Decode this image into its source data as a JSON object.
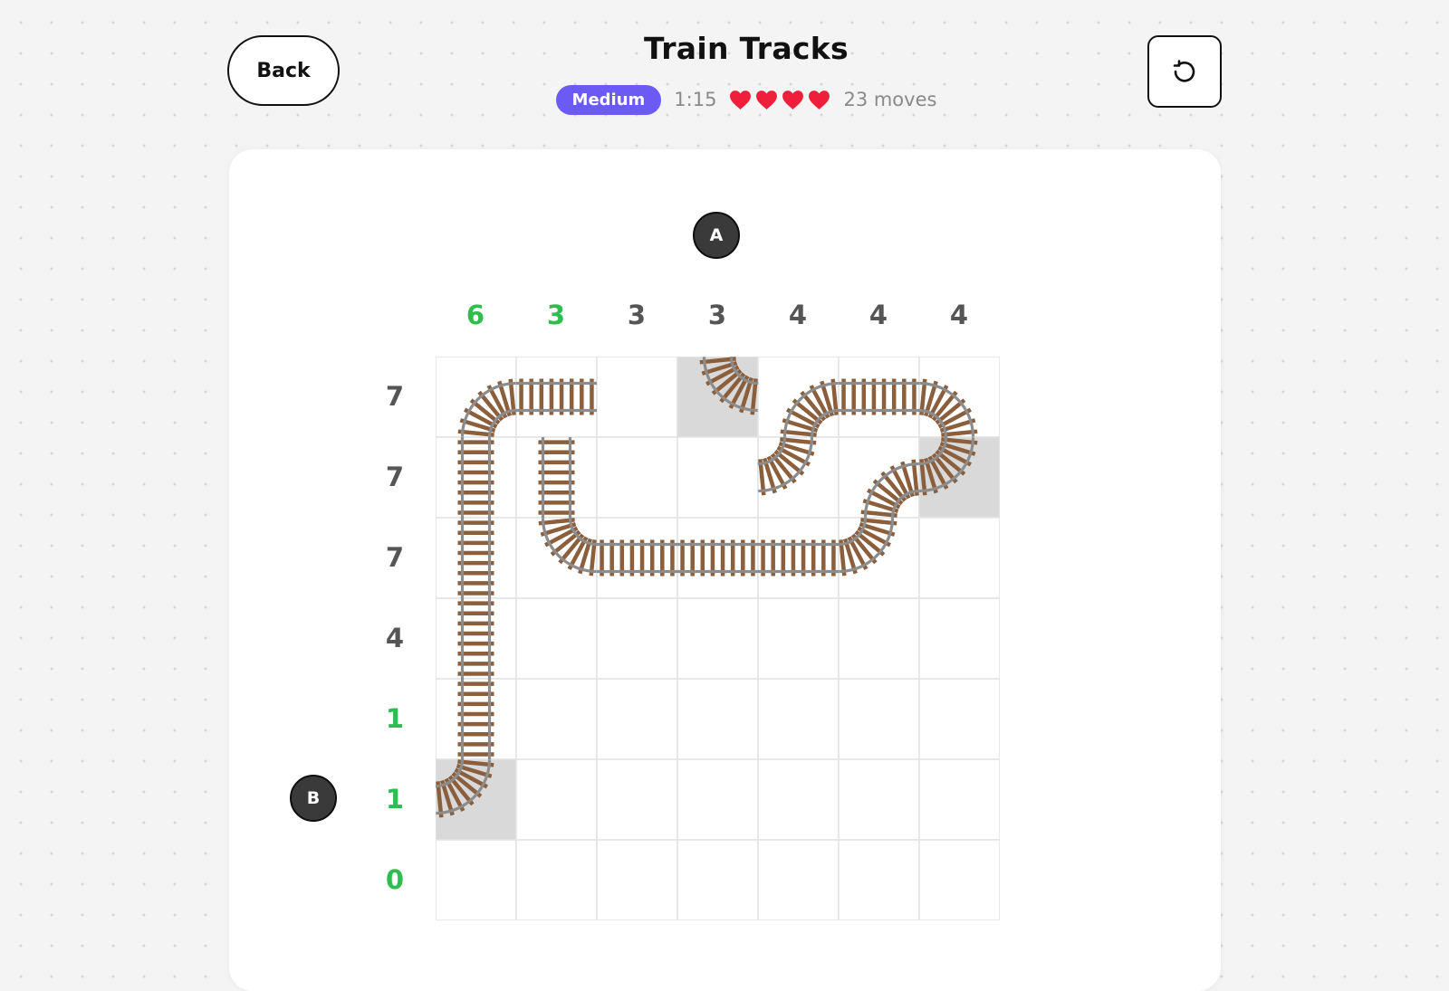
{
  "header": {
    "back_label": "Back",
    "title": "Train Tracks",
    "difficulty": "Medium",
    "timer": "1:15",
    "lives": 4,
    "moves": "23 moves",
    "accent_color": "#6b5bf4"
  },
  "icons": {
    "reset": "reset-icon",
    "heart": "heart-icon"
  },
  "puzzle": {
    "size": 7,
    "col_clues": [
      "6",
      "3",
      "3",
      "3",
      "4",
      "4",
      "4"
    ],
    "col_satisfied": [
      true,
      true,
      false,
      false,
      false,
      false,
      false
    ],
    "row_clues": [
      "7",
      "7",
      "7",
      "4",
      "1",
      "1",
      "0"
    ],
    "row_satisfied": [
      false,
      false,
      false,
      false,
      true,
      true,
      true
    ],
    "station_a": "A",
    "station_b": "B",
    "satisfied_color": "#2ebd4e",
    "unsatisfied_color": "#555555",
    "cells": [
      [
        "ES",
        "EW",
        "",
        "NE",
        "ES",
        "EW",
        "SW"
      ],
      [
        "NS",
        "NS",
        "",
        "",
        "NW",
        "ES",
        "NW"
      ],
      [
        "NS",
        "NE",
        "EW",
        "EW",
        "EW",
        "NW",
        ""
      ],
      [
        "NS",
        "",
        "",
        "",
        "",
        "",
        ""
      ],
      [
        "NS",
        "",
        "",
        "",
        "",
        "",
        ""
      ],
      [
        "NW",
        "",
        "",
        "",
        "",
        "",
        ""
      ],
      [
        "",
        "",
        "",
        "",
        "",
        "",
        ""
      ]
    ],
    "fixed": [
      [
        0,
        3
      ],
      [
        1,
        6
      ],
      [
        5,
        0
      ]
    ]
  }
}
